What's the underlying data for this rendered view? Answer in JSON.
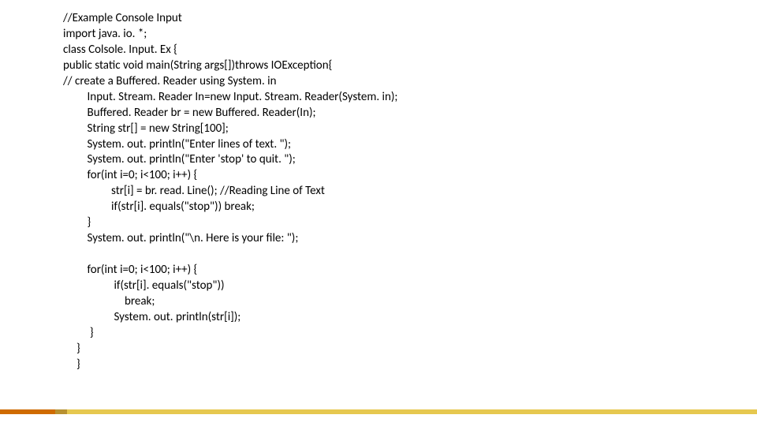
{
  "code": {
    "l1": "//Example Console Input",
    "l2": "import java. io. *;",
    "l3": "class Colsole. Input. Ex {",
    "l4": "public static void main(String args[])throws IOException{",
    "l5": "// create a Buffered. Reader using System. in",
    "l6": "Input. Stream. Reader In=new Input. Stream. Reader(System. in);",
    "l7": "Buffered. Reader br = new Buffered. Reader(In);",
    "l8": "String str[] = new String[100];",
    "l9": "System. out. println(\"Enter lines of text. \");",
    "l10": "System. out. println(\"Enter 'stop' to quit. \");",
    "l11": "for(int i=0; i<100; i++) {",
    "l12": "str[i] = br. read. Line(); //Reading Line of Text",
    "l13": "if(str[i]. equals(\"stop\")) break;",
    "l14": "}",
    "l15": "System. out. println(\"\\n. Here is your file: \");",
    "l16": "",
    "l17": "for(int i=0; i<100; i++) {",
    "l18": "if(str[i]. equals(\"stop\"))",
    "l19": " break;",
    "l20": "System. out. println(str[i]);",
    "l21": "}",
    "l22": "}",
    "l23": "}"
  }
}
